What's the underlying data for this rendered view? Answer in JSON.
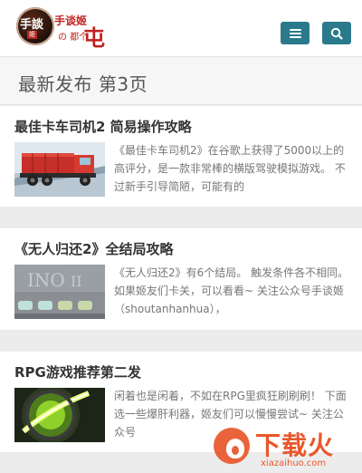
{
  "header": {
    "logo_circle_text": "手談",
    "logo_stamp": "姬",
    "logo_name": "手谈姬",
    "logo_name2": "の 都个",
    "logo_big": "屯"
  },
  "page_title": "最新发布 第3页",
  "articles": [
    {
      "title": "最佳卡车司机2 简易操作攻略",
      "excerpt": "《最佳卡车司机2》在谷歌上获得了5000以上的高评分，是一款非常棒的横版驾驶模拟游戏。 不过新手引导简陋，可能有的"
    },
    {
      "title": "《无人归还2》全结局攻略",
      "excerpt": "《无人归还2》有6个结局。 触发条件各不相同。 如果姬友们卡关，可以看看~ 关注公众号手谈姬（shoutanhanhua），"
    },
    {
      "title": "RPG游戏推荐第二发",
      "excerpt": "闲着也是闲着，不如在RPG里疯狂刷刷刷！ 下面选一些爆肝利器，姬友们可以慢慢尝试~ 关注公众号"
    }
  ],
  "watermark": {
    "text": "下载火",
    "url": "xiazaihuo.com"
  },
  "colors": {
    "button": "#2b7a8c",
    "brand_red": "#c0201f",
    "watermark": "#e9572b"
  }
}
